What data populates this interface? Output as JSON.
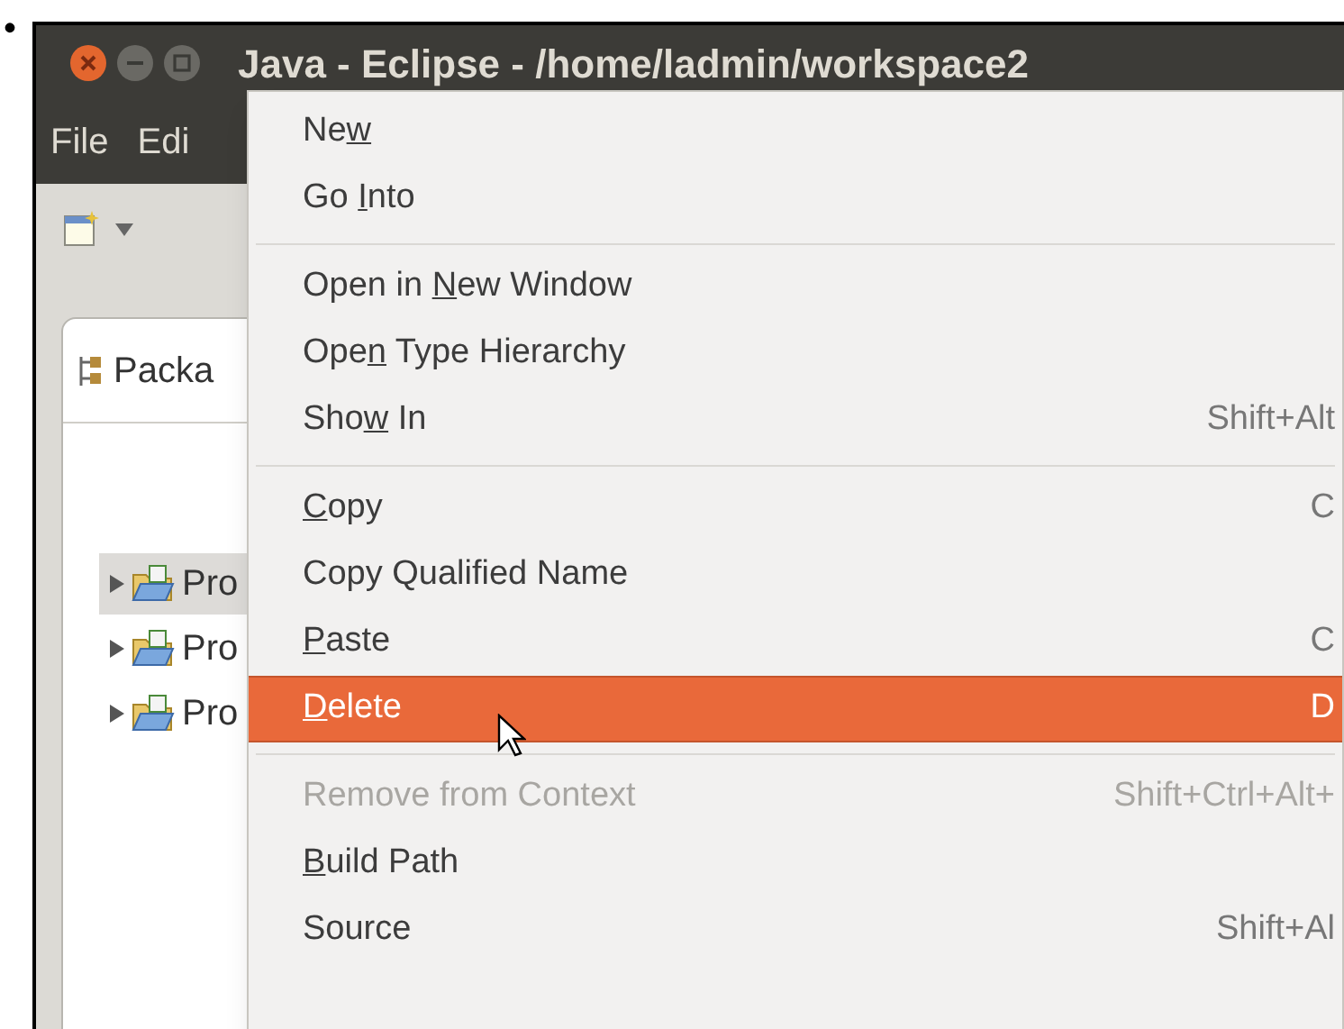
{
  "bullet": "•",
  "window": {
    "title": "Java - Eclipse - /home/ladmin/workspace2"
  },
  "menubar": [
    "File",
    "Edi"
  ],
  "package_explorer": {
    "tab": "Packa",
    "rows": [
      {
        "label": "Pro",
        "selected": true
      },
      {
        "label": "Pro",
        "selected": false
      },
      {
        "label": "Pro",
        "selected": false
      }
    ]
  },
  "context_menu": [
    {
      "kind": "item",
      "label": {
        "pre": "Ne",
        "key": "w"
      },
      "selected": false,
      "disabled": false
    },
    {
      "kind": "item",
      "label": {
        "pre": "Go ",
        "key": "I",
        "post": "nto"
      },
      "selected": false,
      "disabled": false
    },
    {
      "kind": "separator"
    },
    {
      "kind": "item",
      "label": {
        "pre": "Open in ",
        "key": "N",
        "post": "ew Window"
      },
      "selected": false,
      "disabled": false
    },
    {
      "kind": "item",
      "label": {
        "pre": "Ope",
        "key": "n",
        "post": " Type Hierarchy"
      },
      "selected": false,
      "disabled": false
    },
    {
      "kind": "item",
      "label": {
        "pre": "Sho",
        "key": "w",
        "post": " In"
      },
      "shortcut": "Shift+Alt",
      "selected": false,
      "disabled": false
    },
    {
      "kind": "separator"
    },
    {
      "kind": "item",
      "label": {
        "key": "C",
        "post": "opy"
      },
      "shortcut": "C",
      "selected": false,
      "disabled": false
    },
    {
      "kind": "item",
      "label": {
        "pre": "Copy Qualified Name"
      },
      "selected": false,
      "disabled": false
    },
    {
      "kind": "item",
      "label": {
        "key": "P",
        "post": "aste"
      },
      "shortcut": "C",
      "selected": false,
      "disabled": false
    },
    {
      "kind": "item",
      "label": {
        "key": "D",
        "post": "elete"
      },
      "shortcut": "D",
      "selected": true,
      "disabled": false
    },
    {
      "kind": "separator"
    },
    {
      "kind": "item",
      "label": {
        "pre": "Remove from Context"
      },
      "shortcut": "Shift+Ctrl+Alt+",
      "selected": false,
      "disabled": true
    },
    {
      "kind": "item",
      "label": {
        "key": "B",
        "post": "uild Path"
      },
      "selected": false,
      "disabled": false
    },
    {
      "kind": "item",
      "label": {
        "pre": "Source"
      },
      "shortcut": "Shift+Al",
      "selected": false,
      "disabled": false
    }
  ]
}
